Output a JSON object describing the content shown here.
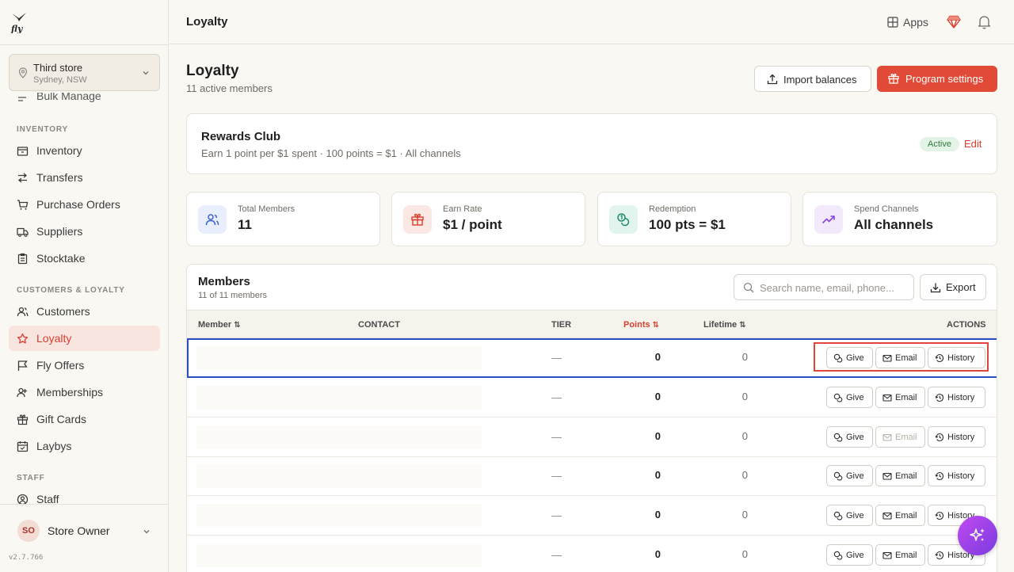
{
  "sidebar": {
    "store_name": "Third store",
    "store_location": "Sydney, NSW",
    "cut_item": "Bulk Manage",
    "sections": {
      "inventory": "INVENTORY",
      "customers": "CUSTOMERS & LOYALTY",
      "staff": "STAFF"
    },
    "inventory_items": [
      "Inventory",
      "Transfers",
      "Purchase Orders",
      "Suppliers",
      "Stocktake"
    ],
    "customer_items": [
      "Customers",
      "Loyalty",
      "Fly Offers",
      "Memberships",
      "Gift Cards",
      "Laybys"
    ],
    "staff_items": [
      "Staff"
    ],
    "user_initials": "SO",
    "user_name": "Store Owner",
    "version": "v2.7.766"
  },
  "topbar": {
    "title": "Loyalty",
    "apps_label": "Apps"
  },
  "page": {
    "title": "Loyalty",
    "subtitle": "11 active members",
    "import_label": "Import balances",
    "settings_label": "Program settings"
  },
  "program": {
    "title": "Rewards Club",
    "description": "Earn 1 point per $1 spent · 100 points = $1 · All channels",
    "status": "Active",
    "edit_label": "Edit"
  },
  "stats": [
    {
      "label": "Total Members",
      "value": "11",
      "icon": "users-icon"
    },
    {
      "label": "Earn Rate",
      "value": "$1 / point",
      "icon": "gift-icon"
    },
    {
      "label": "Redemption",
      "value": "100 pts = $1",
      "icon": "coins-icon"
    },
    {
      "label": "Spend Channels",
      "value": "All channels",
      "icon": "trending-up-icon"
    }
  ],
  "members": {
    "title": "Members",
    "count_text": "11 of 11 members",
    "search_placeholder": "Search name, email, phone...",
    "export_label": "Export",
    "columns": {
      "member": "Member",
      "contact": "CONTACT",
      "tier": "TIER",
      "points": "Points",
      "lifetime": "Lifetime",
      "actions": "ACTIONS"
    },
    "action_labels": {
      "give": "Give",
      "email": "Email",
      "history": "History"
    },
    "rows": [
      {
        "tier": "—",
        "points": "0",
        "lifetime": "0"
      },
      {
        "tier": "—",
        "points": "0",
        "lifetime": "0"
      },
      {
        "tier": "—",
        "points": "0",
        "lifetime": "0"
      },
      {
        "tier": "—",
        "points": "0",
        "lifetime": "0"
      },
      {
        "tier": "—",
        "points": "0",
        "lifetime": "0"
      },
      {
        "tier": "—",
        "points": "0",
        "lifetime": "0"
      }
    ]
  },
  "colors": {
    "accent": "#e14a36",
    "active_nav_bg": "#f8e5df",
    "selection_outline": "#2a4fc0",
    "highlight_box": "#e0443a"
  }
}
